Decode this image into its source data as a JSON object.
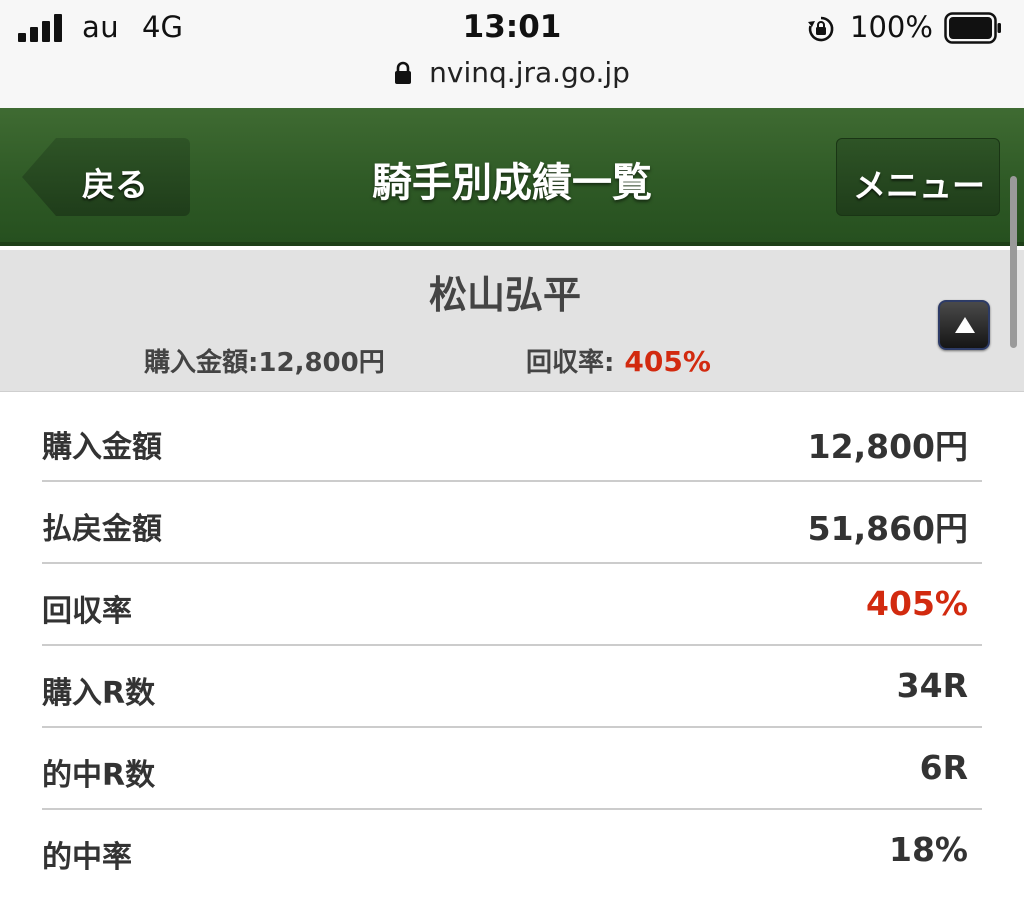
{
  "status_bar": {
    "carrier": "au",
    "network": "4G",
    "time": "13:01",
    "battery": "100%",
    "url": "nvinq.jra.go.jp"
  },
  "header": {
    "back_label": "戻る",
    "title": "騎手別成績一覧",
    "menu_label": "メニュー"
  },
  "summary": {
    "jockey_name": "松山弘平",
    "purchase_text": "購入金額:12,800円",
    "rate_label": "回収率:",
    "rate_value": "405%"
  },
  "stats": [
    {
      "label": "購入金額",
      "value": "12,800円"
    },
    {
      "label": "払戻金額",
      "value": "51,860円"
    },
    {
      "label": "回収率",
      "value": "405%"
    },
    {
      "label": "購入R数",
      "value": "34R"
    },
    {
      "label": "的中R数",
      "value": "6R"
    },
    {
      "label": "的中率",
      "value": "18%"
    }
  ],
  "colors": {
    "header_green": "#2f5a26",
    "accent_red": "#d22a0f",
    "summary_gray": "#e2e2e2"
  },
  "icons": {
    "lock": "lock-icon",
    "signal": "signal-bars-icon",
    "rotation_lock": "rotation-lock-icon",
    "battery": "battery-icon",
    "collapse": "triangle-up-icon"
  }
}
